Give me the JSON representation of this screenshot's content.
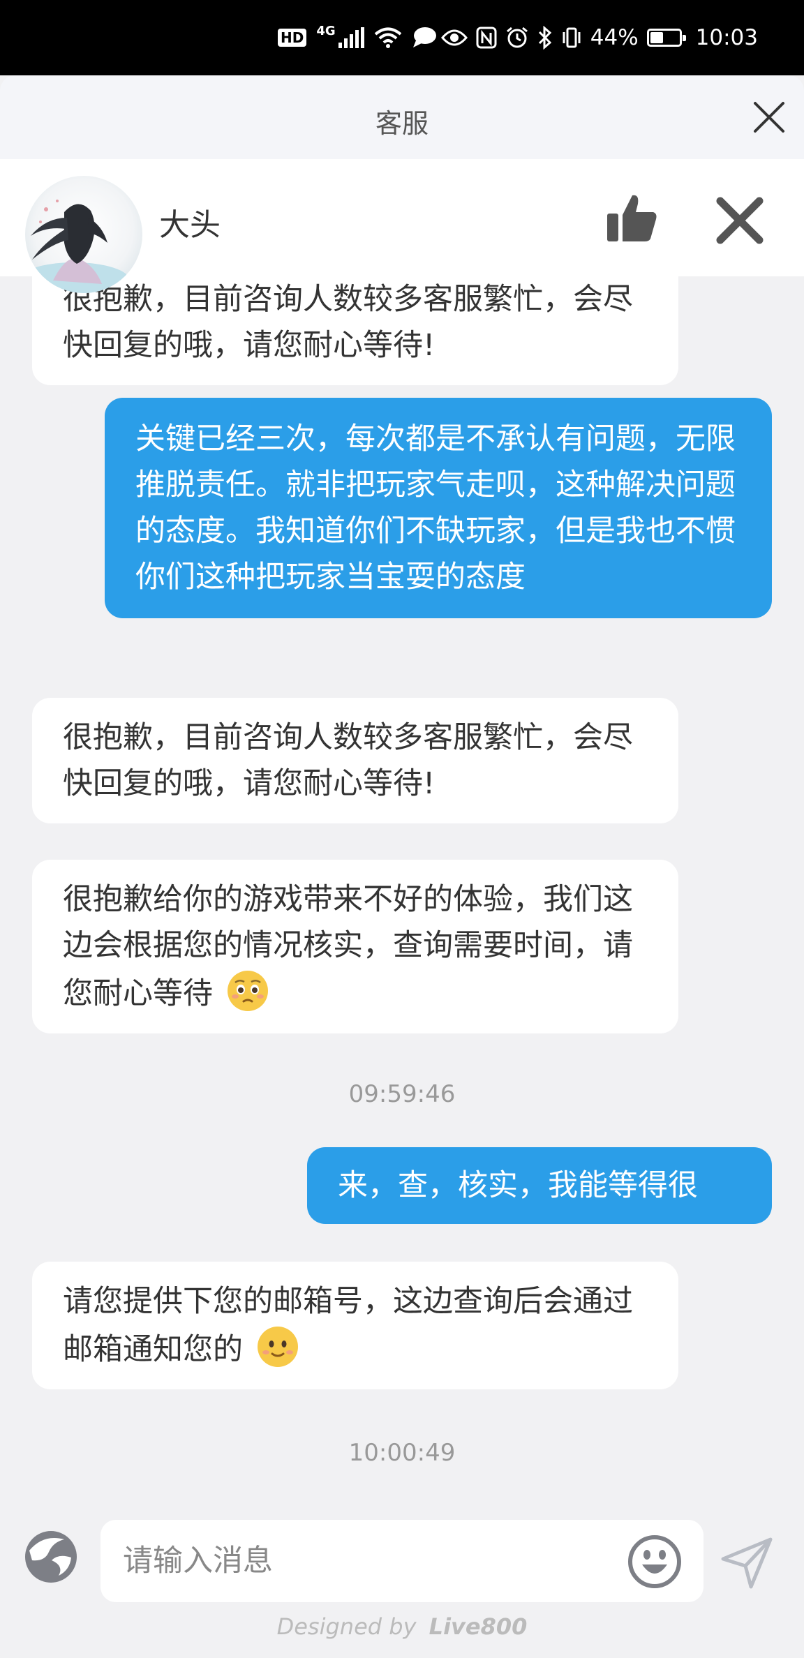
{
  "status_bar": {
    "hd_badge": "HD",
    "network": "4G",
    "battery_text": "44%",
    "battery_level": 0.44,
    "time": "10:03"
  },
  "header": {
    "title": "客服"
  },
  "agent": {
    "name": "大头"
  },
  "messages": [
    {
      "side": "in",
      "text": "很抱歉，目前咨询人数较多客服繁忙，会尽快回复的哦，请您耐心等待!"
    },
    {
      "side": "out",
      "text": "关键已经三次，每次都是不承认有问题，无限推脱责任。就非把玩家气走呗，这种解决问题的态度。我知道你们不缺玩家，但是我也不惯你们这种把玩家当宝耍的态度"
    },
    {
      "side": "in",
      "text": "很抱歉，目前咨询人数较多客服繁忙，会尽快回复的哦，请您耐心等待!"
    },
    {
      "side": "in",
      "text": "很抱歉给你的游戏带来不好的体验，我们这边会根据您的情况核实，查询需要时间，请您耐心等待",
      "emoji": "pleading-face"
    },
    {
      "timestamp": "09:59:46"
    },
    {
      "side": "out",
      "text": "来，查，核实，我能等得很"
    },
    {
      "side": "in",
      "text": "请您提供下您的邮箱号，这边查询后会通过邮箱通知您的",
      "emoji": "smiling-face"
    },
    {
      "timestamp": "10:00:49"
    }
  ],
  "input": {
    "placeholder": "请输入消息"
  },
  "footer": {
    "designed_by": "Designed by",
    "brand": "Live800"
  },
  "colors": {
    "outgoing_bubble": "#2b9ee8",
    "incoming_bubble": "#ffffff",
    "background": "#f1f1f3"
  },
  "icons": [
    "signal-icon",
    "wifi-icon",
    "chat-icon",
    "eye-icon",
    "nfc-icon",
    "alarm-icon",
    "bluetooth-icon",
    "vibrate-icon",
    "battery-icon",
    "close-icon",
    "thumbs-up-icon",
    "theme-icon",
    "emoji-icon",
    "send-icon"
  ]
}
